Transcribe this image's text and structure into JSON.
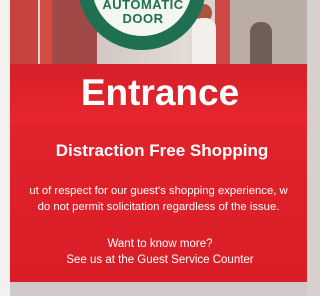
{
  "door_sign": {
    "text": "AUTOMATIC\nDOOR"
  },
  "sign": {
    "title": "Entrance",
    "subtitle": "Distraction Free Shopping",
    "body": "ut of respect for our guest's shopping experience, w\ndo not permit solicitation regardless of the issue.",
    "cta": "Want to know more?\nSee us at the Guest Service Counter"
  },
  "colors": {
    "sign_red": "#e2262f",
    "door_sign_green": "#1f6f53"
  }
}
